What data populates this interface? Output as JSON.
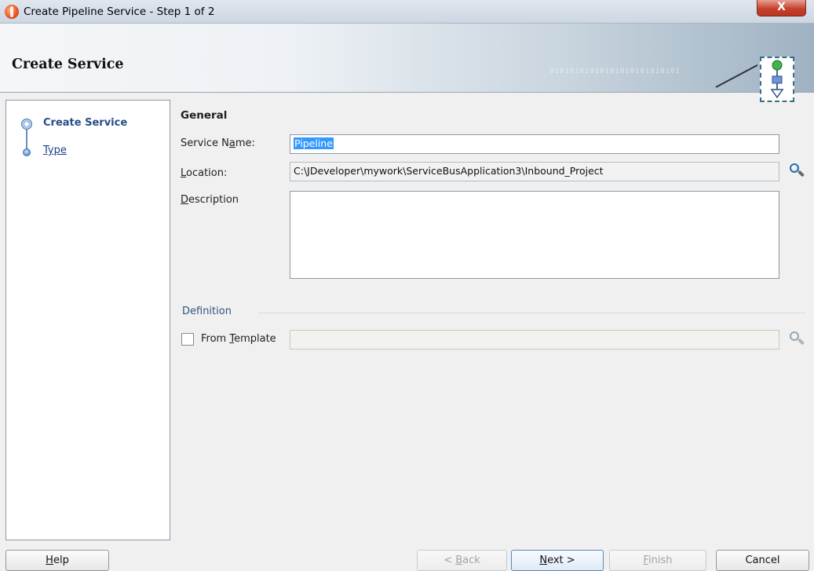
{
  "window": {
    "title": "Create Pipeline Service - Step 1 of 2",
    "close_label": "X"
  },
  "header": {
    "heading": "Create Service",
    "binary_text": "01010101010101010101010101"
  },
  "nav": {
    "steps": [
      {
        "label": "Create Service",
        "state": "active"
      },
      {
        "label": "Type",
        "state": "link"
      }
    ]
  },
  "form": {
    "section_title": "General",
    "service_name": {
      "label_pre": "Service N",
      "label_mnemonic": "a",
      "label_post": "me:",
      "value": "Pipeline"
    },
    "location": {
      "label_mnemonic": "L",
      "label_post": "ocation:",
      "value": "C:\\JDeveloper\\mywork\\ServiceBusApplication3\\Inbound_Project"
    },
    "description": {
      "label_mnemonic": "D",
      "label_post": "escription",
      "value": ""
    },
    "definition": {
      "legend": "Definition",
      "from_template_pre": "From ",
      "from_template_mnemonic": "T",
      "from_template_post": "emplate",
      "checked": false,
      "template_value": ""
    }
  },
  "buttons": {
    "help": {
      "mnemonic": "H",
      "rest": "elp"
    },
    "back": {
      "pre": "< ",
      "mnemonic": "B",
      "rest": "ack"
    },
    "next": {
      "mnemonic": "N",
      "rest": "ext >"
    },
    "finish": {
      "mnemonic": "F",
      "rest": "inish"
    },
    "cancel": {
      "label": "Cancel"
    }
  },
  "colors": {
    "accent": "#254e87",
    "selection": "#3399ff",
    "close_button": "#c7412c"
  },
  "icons": [
    "app-icon",
    "wizard-icon",
    "search-icon",
    "step-dot-icon"
  ]
}
